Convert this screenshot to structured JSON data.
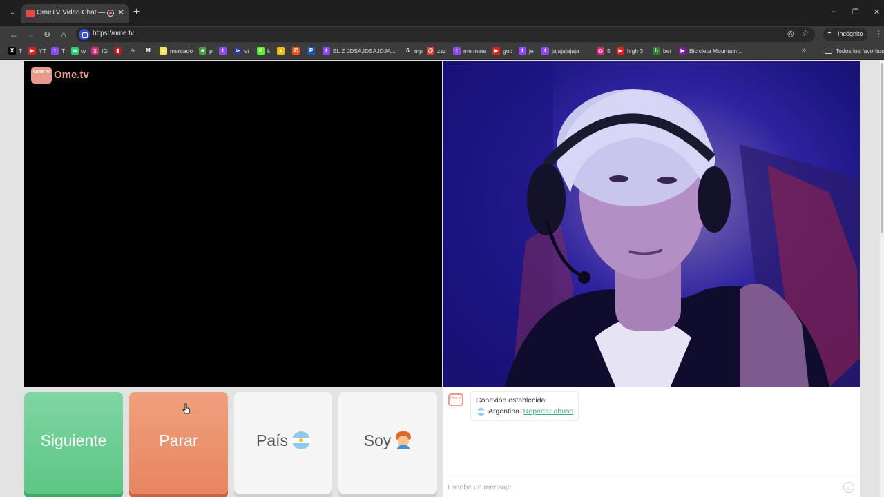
{
  "browser": {
    "tab_title": "OmeTV Video Chat — Ome",
    "tab_close": "✕",
    "new_tab": "+",
    "url": "https://ome.tv",
    "incognito_label": "Incógnito",
    "window_controls": {
      "minimize": "–",
      "restore": "❐",
      "close": "✕"
    },
    "bookmarks": [
      {
        "label": "T",
        "icon": "x-icon",
        "color": "#000000",
        "glyph": "X"
      },
      {
        "label": "YT",
        "icon": "youtube-icon",
        "color": "#e62117",
        "glyph": "▶"
      },
      {
        "label": "T",
        "icon": "twitch-icon",
        "color": "#9146ff",
        "glyph": "t"
      },
      {
        "label": "w",
        "icon": "whatsapp-icon",
        "color": "#25d366",
        "glyph": "w"
      },
      {
        "label": "IG",
        "icon": "instagram-icon",
        "color": "#d62976",
        "glyph": "◎"
      },
      {
        "label": "",
        "icon": "red-app-icon",
        "color": "#b71c1c",
        "glyph": "▮"
      },
      {
        "label": "",
        "icon": "steam-icon",
        "color": "#3c3c3c",
        "glyph": "✈"
      },
      {
        "label": "",
        "icon": "gmail-icon",
        "color": "#3c3c3c",
        "glyph": "M"
      },
      {
        "label": "mercado",
        "icon": "mercadolibre-icon",
        "color": "#f5e35a",
        "glyph": "●"
      },
      {
        "label": "p",
        "icon": "green-app-icon",
        "color": "#43a047",
        "glyph": "♣"
      },
      {
        "label": "",
        "icon": "twitch-icon",
        "color": "#9146ff",
        "glyph": "t"
      },
      {
        "label": "vt",
        "icon": "vt-icon",
        "color": "#2b3a8f",
        "glyph": "⋗"
      },
      {
        "label": "k",
        "icon": "kick-icon",
        "color": "#53fc18",
        "glyph": "K"
      },
      {
        "label": "",
        "icon": "drive-icon",
        "color": "#fbbc04",
        "glyph": "▲"
      },
      {
        "label": "",
        "icon": "orange-app-icon",
        "color": "#f4511e",
        "glyph": "C"
      },
      {
        "label": "",
        "icon": "paypal-icon",
        "color": "#1e56b8",
        "glyph": "P"
      },
      {
        "label": "EL Z JDSAJDSAJDJA...",
        "icon": "twitch-icon",
        "color": "#9146ff",
        "glyph": "t"
      },
      {
        "label": "mp",
        "icon": "six-icon",
        "color": "#3c3c3c",
        "glyph": "6"
      },
      {
        "label": "zzz",
        "icon": "red-circle-icon",
        "color": "#e53935",
        "glyph": "@"
      },
      {
        "label": "me mate",
        "icon": "twitch-icon",
        "color": "#9146ff",
        "glyph": "t"
      },
      {
        "label": "god",
        "icon": "youtube-icon",
        "color": "#e62117",
        "glyph": "▶"
      },
      {
        "label": "je",
        "icon": "twitch-icon",
        "color": "#9146ff",
        "glyph": "t"
      },
      {
        "label": "jajajajajaja",
        "icon": "twitch-icon",
        "color": "#9146ff",
        "glyph": "t"
      },
      {
        "label": "5",
        "icon": "instagram-icon",
        "color": "#d62976",
        "glyph": "◎"
      },
      {
        "label": "high 3",
        "icon": "youtube-icon",
        "color": "#e62117",
        "glyph": "▶"
      },
      {
        "label": "bet",
        "icon": "bet-icon",
        "color": "#2e7d32",
        "glyph": "b"
      },
      {
        "label": "Bicicleta Mountain...",
        "icon": "purple-arrow-icon",
        "color": "#7b1fa2",
        "glyph": "▶"
      }
    ],
    "all_bookmarks_label": "Todos los favoritos"
  },
  "page": {
    "logo_badge": "Ome tv",
    "logo_text": "Ome.tv",
    "buttons": {
      "next": "Siguiente",
      "stop": "Parar",
      "country": "País",
      "me": "Soy"
    },
    "chat": {
      "status": "Conexión establecida.",
      "country": "Argentina.",
      "report": "Reportar abuso",
      "report_suffix": ".",
      "input_placeholder": "Escribe un mensaje"
    }
  }
}
